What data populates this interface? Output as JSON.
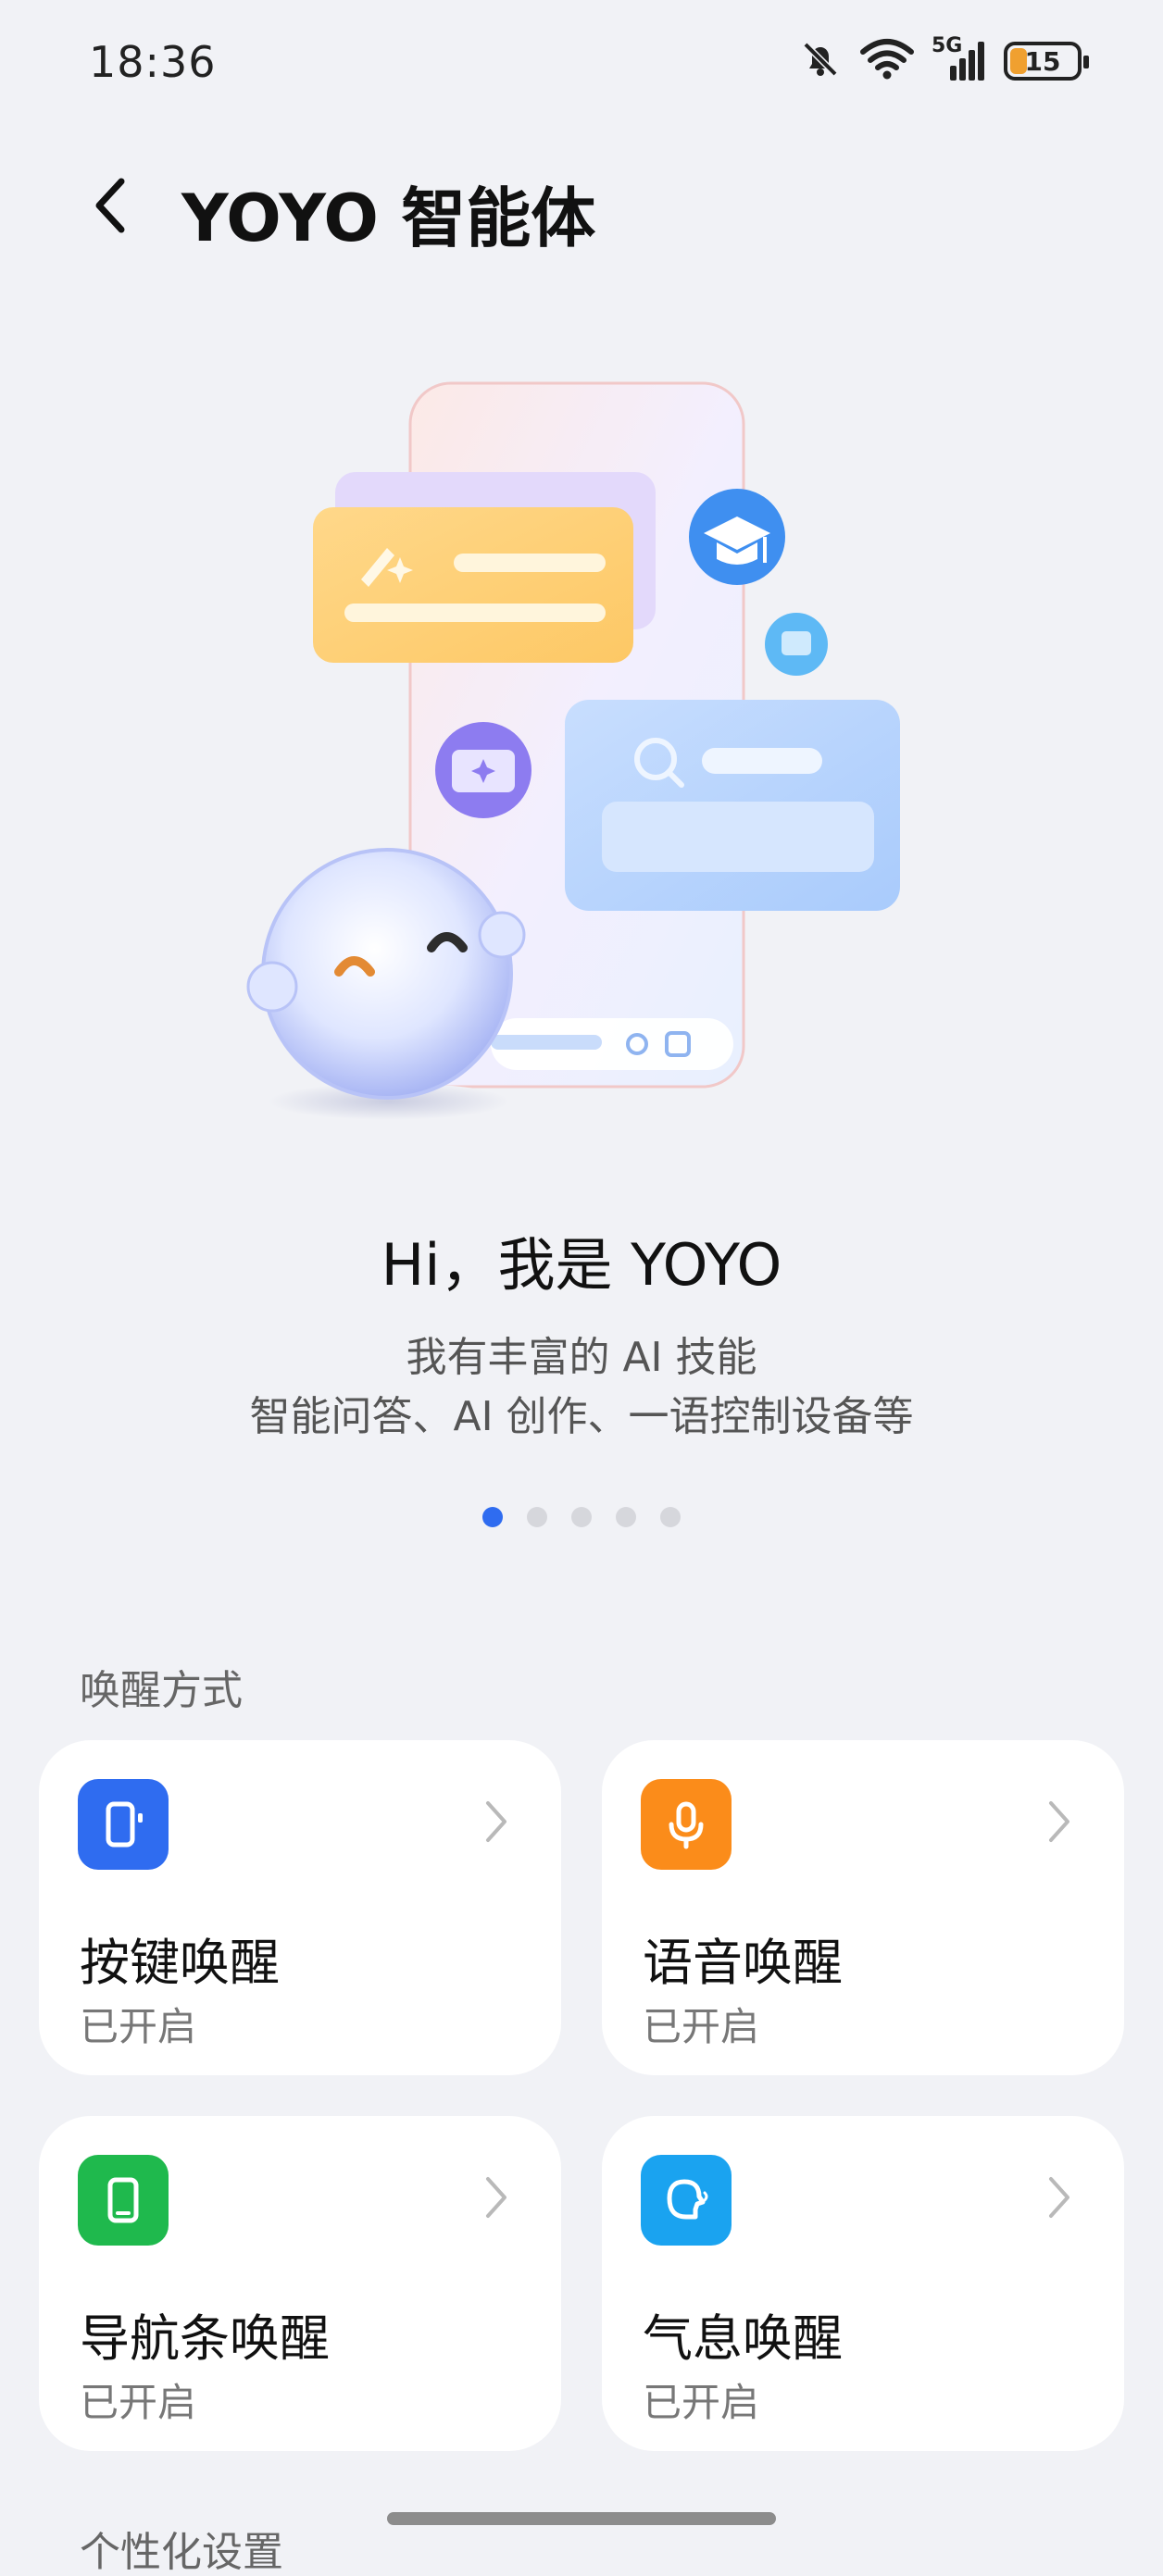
{
  "status_bar": {
    "time": "18:36",
    "network": "5G",
    "battery": "15",
    "battery_level_percent": 15,
    "icons": [
      "mute-bell-icon",
      "wifi-icon",
      "cellular-signal-icon",
      "battery-icon"
    ]
  },
  "header": {
    "title": "YOYO 智能体",
    "back_icon": "chevron-left-icon"
  },
  "hero": {
    "title": "Hi，我是 YOYO",
    "line1": "我有丰富的 AI 技能",
    "line2": "智能问答、AI 创作、一语控制设备等",
    "page_count": 5,
    "active_page": 1
  },
  "wake_section": {
    "label": "唤醒方式",
    "cards": [
      {
        "name": "按键唤醒",
        "state": "已开启",
        "icon": "phone-key-icon",
        "color": "#2f6cf0"
      },
      {
        "name": "语音唤醒",
        "state": "已开启",
        "icon": "microphone-icon",
        "color": "#fb8c1a"
      },
      {
        "name": "导航条唤醒",
        "state": "已开启",
        "icon": "phone-nav-icon",
        "color": "#1fb94d"
      },
      {
        "name": "气息唤醒",
        "state": "已开启",
        "icon": "breath-icon",
        "color": "#1aa3f0"
      }
    ]
  },
  "next_section": {
    "label": "个性化设置"
  },
  "colors": {
    "background": "#f1f2f6",
    "accent": "#2f6cf0"
  }
}
